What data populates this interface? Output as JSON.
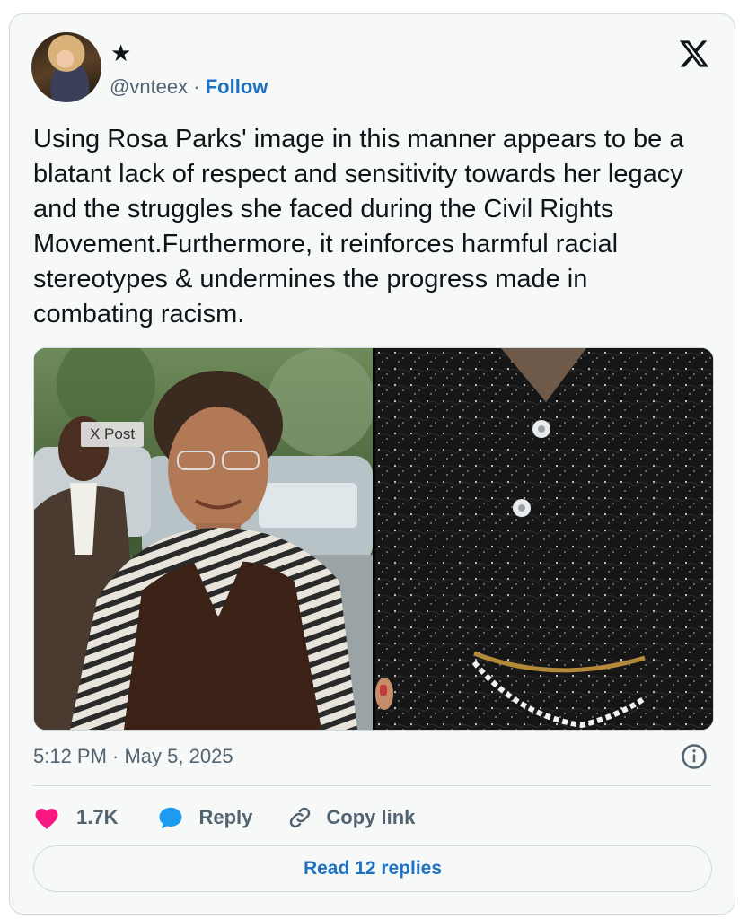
{
  "author": {
    "display_name": "★",
    "handle": "@vnteex",
    "separator": "·",
    "follow_label": "Follow"
  },
  "tweet": {
    "text": "Using Rosa Parks' image in this manner appears to be a blatant lack of respect and sensitivity towards her legacy and the struggles she faced during the Civil Rights Movement.Furthermore, it reinforces harmful racial stereotypes & undermines the progress made in combating racism.",
    "media_badge": "X Post",
    "timestamp": "5:12 PM · May 5, 2025"
  },
  "actions": {
    "like_count": "1.7K",
    "reply_label": "Reply",
    "copy_link_label": "Copy link"
  },
  "footer": {
    "read_replies_label": "Read 12 replies"
  },
  "colors": {
    "accent": "#1d72c2",
    "like": "#f91880",
    "reply_bubble": "#1d9bf0",
    "muted": "#536471",
    "border": "#cfd9de"
  },
  "icons": [
    "x-logo-icon",
    "heart-icon",
    "chat-bubble-icon",
    "link-icon",
    "info-icon"
  ]
}
